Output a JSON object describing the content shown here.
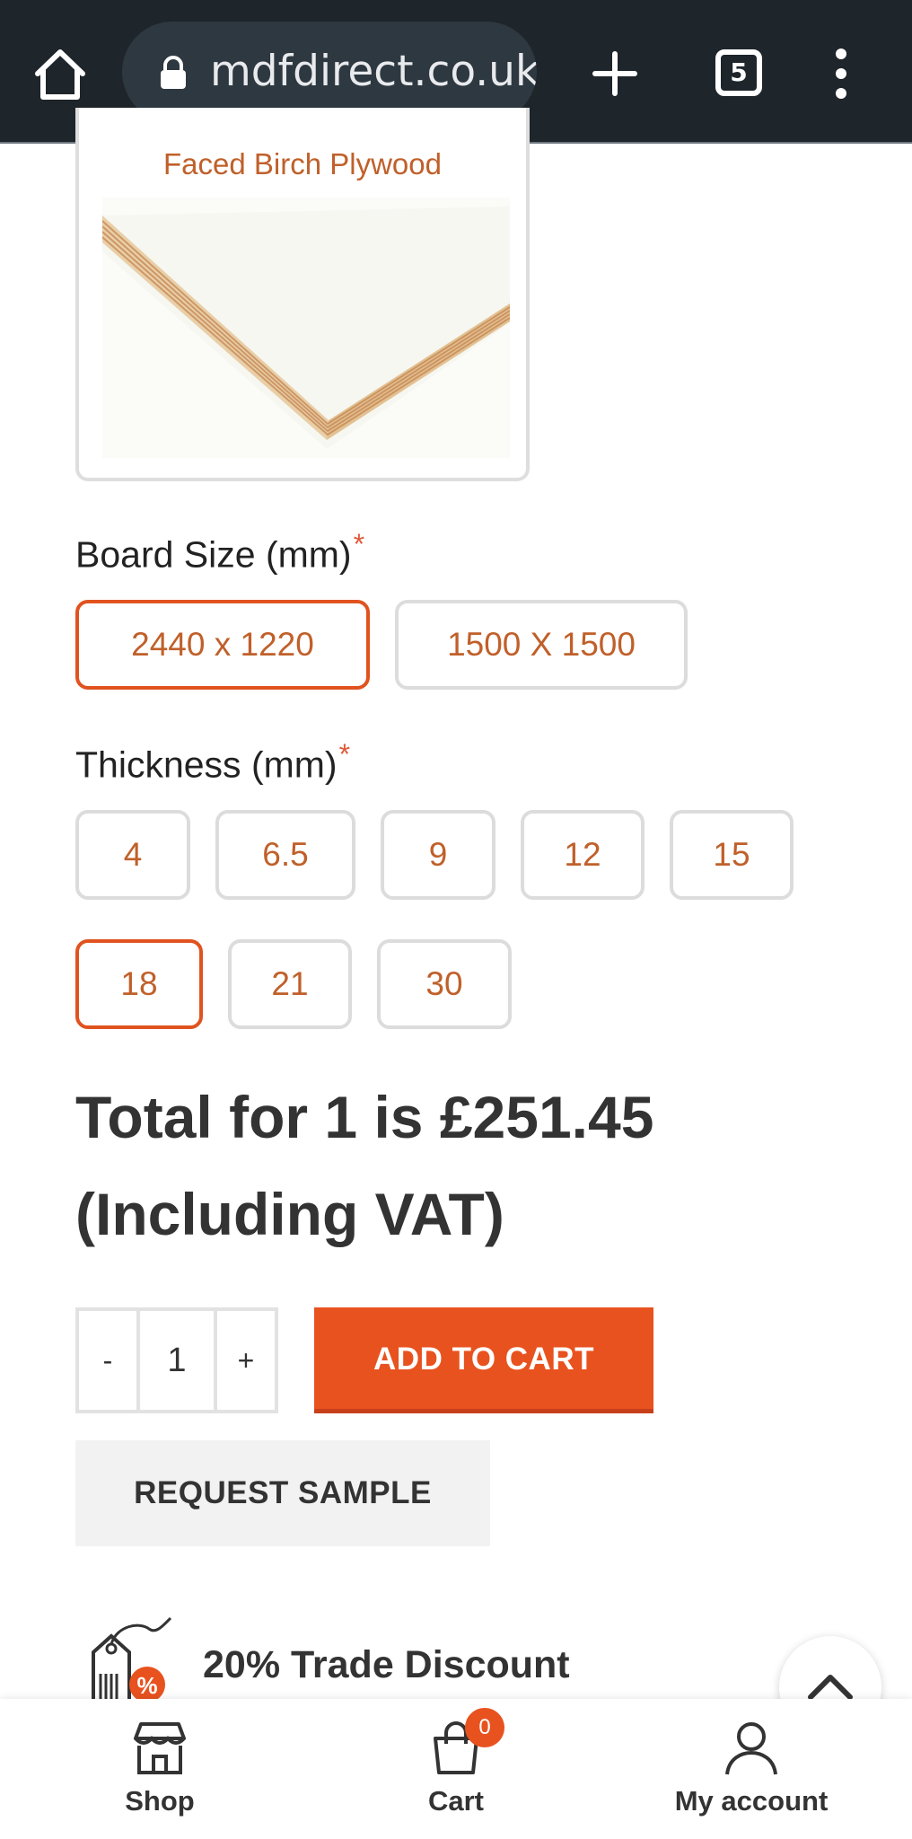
{
  "browser": {
    "url": "mdfdirect.co.uk",
    "tab_count": "5"
  },
  "product": {
    "image_caption": "Faced Birch Plywood"
  },
  "board_size": {
    "label": "Board Size (mm)",
    "required_mark": "*",
    "options": [
      "2440 x 1220",
      "1500 X 1500"
    ],
    "selected": "2440 x 1220"
  },
  "thickness": {
    "label": "Thickness (mm)",
    "required_mark": "*",
    "options": [
      "4",
      "6.5",
      "9",
      "12",
      "15",
      "18",
      "21",
      "30"
    ],
    "selected": "18"
  },
  "total": {
    "line1": "Total for 1 is £251.45",
    "line2": "(Including VAT)"
  },
  "quantity": {
    "minus": "-",
    "value": "1",
    "plus": "+"
  },
  "buttons": {
    "add_to_cart": "ADD TO CART",
    "request_sample": "REQUEST SAMPLE"
  },
  "promo": {
    "text": "20% Trade Discount"
  },
  "bottom_nav": {
    "shop": "Shop",
    "cart": "Cart",
    "cart_count": "0",
    "account": "My account"
  },
  "colors": {
    "accent": "#e8521f",
    "option_text": "#c0602a",
    "toolbar": "#1e252b"
  }
}
